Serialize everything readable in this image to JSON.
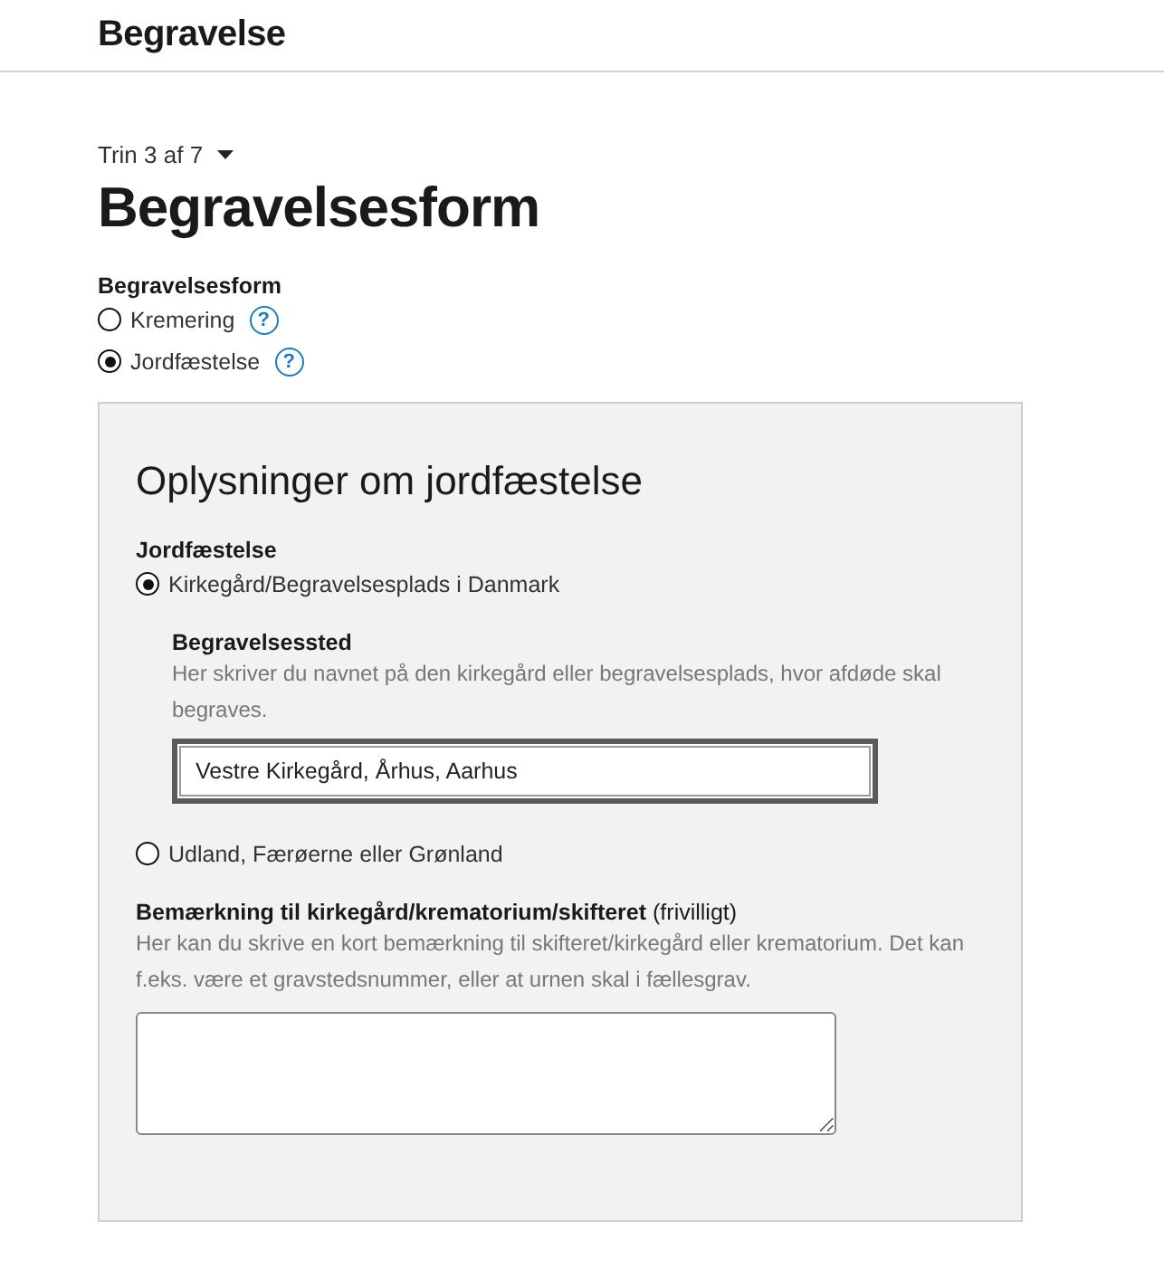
{
  "header": {
    "title": "Begravelse"
  },
  "step": {
    "label": "Trin 3 af 7"
  },
  "heading": "Begravelsesform",
  "form_type": {
    "label": "Begravelsesform",
    "options": [
      {
        "label": "Kremering",
        "selected": false,
        "help": "?"
      },
      {
        "label": "Jordfæstelse",
        "selected": true,
        "help": "?"
      }
    ]
  },
  "panel": {
    "title": "Oplysninger om jordfæstelse",
    "burial": {
      "label": "Jordfæstelse",
      "options": [
        {
          "label": "Kirkegård/Begravelsesplads i Danmark",
          "selected": true,
          "field": {
            "label": "Begravelsessted",
            "hint": "Her skriver du navnet på den kirkegård eller begravelsesplads, hvor afdøde skal begraves.",
            "value": "Vestre Kirkegård, Århus, Aarhus"
          }
        },
        {
          "label": "Udland, Færøerne eller Grønland",
          "selected": false
        }
      ]
    },
    "remark": {
      "label": "**Bemærkning til kirkegård/krematorium/skifteret** (frivilligt)",
      "hint": "Her kan du skrive en kort bemærkning til skifteret/kirkegård eller krematorium. Det kan f.eks. være et gravstedsnummer, eller at urnen skal i fællesgrav."
    }
  }
}
